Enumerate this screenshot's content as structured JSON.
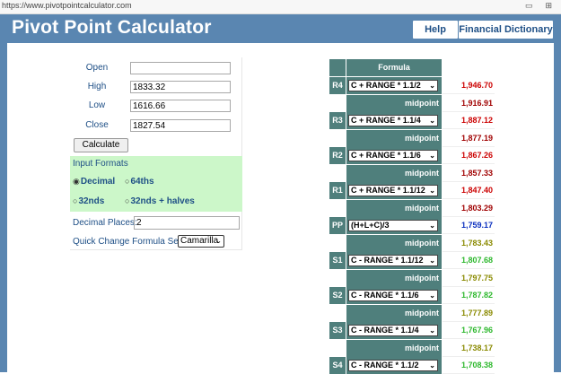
{
  "browser": {
    "url": "https://www.pivotpointcalculator.com",
    "icons": [
      "reader-icon",
      "extensions-icon"
    ]
  },
  "header": {
    "title": "Pivot Point Calculator",
    "nav": {
      "help": "Help",
      "dictionary": "Financial Dictionary"
    }
  },
  "form": {
    "open": {
      "label": "Open",
      "value": ""
    },
    "high": {
      "label": "High",
      "value": "1833.32"
    },
    "low": {
      "label": "Low",
      "value": "1616.66"
    },
    "close": {
      "label": "Close",
      "value": "1827.54"
    },
    "calculate_label": "Calculate",
    "formats": {
      "title": "Input Formats",
      "options": [
        "Decimal",
        "64ths",
        "32nds",
        "32nds + halves"
      ],
      "selected": "Decimal"
    },
    "decimal_places": {
      "label": "Decimal Places:",
      "value": "2"
    },
    "quick_change": {
      "label": "Quick Change Formula Set:",
      "selected": "Camarilla"
    }
  },
  "table": {
    "header": "Formula",
    "midpoint_label": "midpoint",
    "rows": [
      {
        "label": "R4",
        "formula": "C + RANGE * 1.1/2",
        "value": "1,946.70",
        "color": "#cc0000"
      },
      {
        "midpoint": "1,916.91",
        "color": "#a00000"
      },
      {
        "label": "R3",
        "formula": "C + RANGE * 1.1/4",
        "value": "1,887.12",
        "color": "#cc0000"
      },
      {
        "midpoint": "1,877.19",
        "color": "#a00000"
      },
      {
        "label": "R2",
        "formula": "C + RANGE * 1.1/6",
        "value": "1,867.26",
        "color": "#cc0000"
      },
      {
        "midpoint": "1,857.33",
        "color": "#a00000"
      },
      {
        "label": "R1",
        "formula": "C + RANGE * 1.1/12",
        "value": "1,847.40",
        "color": "#cc0000"
      },
      {
        "midpoint": "1,803.29",
        "color": "#a00000"
      },
      {
        "label": "PP",
        "formula": "(H+L+C)/3",
        "value": "1,759.17",
        "color": "#0a2fbf"
      },
      {
        "midpoint": "1,783.43",
        "color": "#8a8a00"
      },
      {
        "label": "S1",
        "formula": "C - RANGE * 1.1/12",
        "value": "1,807.68",
        "color": "#2db82d"
      },
      {
        "midpoint": "1,797.75",
        "color": "#8a8a00"
      },
      {
        "label": "S2",
        "formula": "C - RANGE * 1.1/6",
        "value": "1,787.82",
        "color": "#2db82d"
      },
      {
        "midpoint": "1,777.89",
        "color": "#8a8a00"
      },
      {
        "label": "S3",
        "formula": "C - RANGE * 1.1/4",
        "value": "1,767.96",
        "color": "#2db82d"
      },
      {
        "midpoint": "1,738.17",
        "color": "#8a8a00"
      },
      {
        "label": "S4",
        "formula": "C - RANGE * 1.1/2",
        "value": "1,708.38",
        "color": "#2db82d"
      }
    ]
  }
}
